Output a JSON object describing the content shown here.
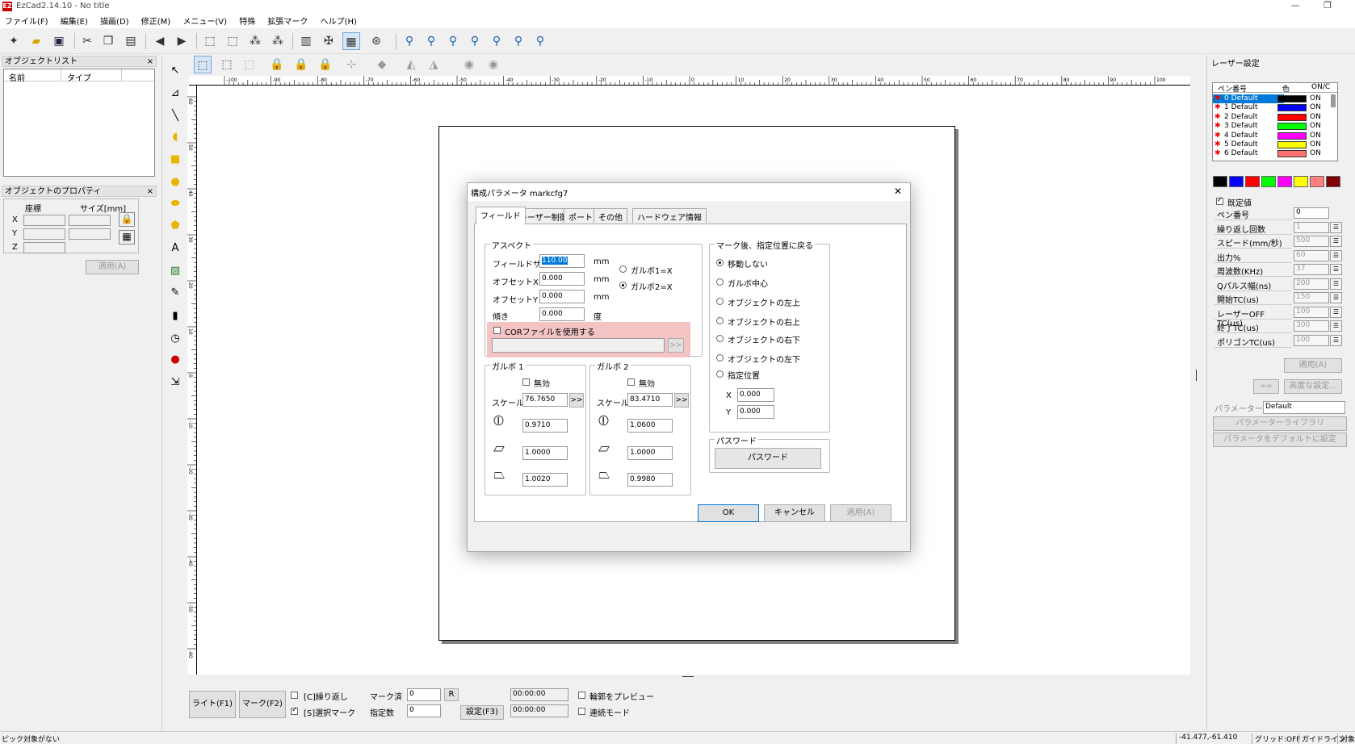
{
  "window": {
    "title": "EzCad2.14.10 - No title",
    "min": "—",
    "max": "❐"
  },
  "menu": [
    "ファイル(F)",
    "編集(E)",
    "描画(D)",
    "修正(M)",
    "メニュー(V)",
    "特殊",
    "拡張マーク",
    "ヘルプ(H)"
  ],
  "object_list": {
    "title": "オブジェクトリスト",
    "close": "×",
    "col_name": "名前",
    "col_type": "タイプ"
  },
  "object_props": {
    "title": "オブジェクトのプロパティ",
    "close": "×",
    "coord_label": "座標",
    "size_label": "サイズ[mm]",
    "x": "X",
    "y": "Y",
    "z": "Z",
    "apply": "適用(A)"
  },
  "ruler": {
    "h": [
      "-100",
      "-90",
      "-80",
      "-70",
      "-60",
      "-50",
      "-40",
      "-30",
      "-20",
      "-10",
      "0",
      "10",
      "20",
      "30",
      "40",
      "50",
      "60",
      "70",
      "80",
      "90",
      "100"
    ],
    "v": [
      "60",
      "50",
      "40",
      "30",
      "20",
      "10",
      "0",
      "-10",
      "-20",
      "-30",
      "-40",
      "-50",
      "-60"
    ]
  },
  "dialog": {
    "title": "構成パラメータ markcfg7",
    "close": "✕",
    "tabs": [
      "フィールド",
      "レーザー制御",
      "ポート",
      "その他",
      "ハードウェア情報"
    ],
    "aspect": {
      "legend": "アスペクト",
      "field_size_label": "フィールドサ",
      "field_size": "110.00",
      "offset_x_label": "オフセットX",
      "offset_x": "0.000",
      "offset_y_label": "オフセットY",
      "offset_y": "0.000",
      "tilt_label": "傾き",
      "tilt": "0.000",
      "unit_mm": "mm",
      "unit_deg": "度",
      "galvo1x": "ガルボ1=X",
      "galvo2x": "ガルボ2=X",
      "cor_label": "CORファイルを使用する",
      "browse": ">>"
    },
    "galvo1": {
      "legend": "ガルボ 1",
      "disable": "無効",
      "scale_label": "スケール",
      "scale": "76.7650",
      "more": ">>",
      "v1": "0.9710",
      "v2": "1.0000",
      "v3": "1.0020"
    },
    "galvo2": {
      "legend": "ガルボ 2",
      "disable": "無効",
      "scale_label": "スケール",
      "scale": "83.4710",
      "more": ">>",
      "v1": "1.0600",
      "v2": "1.0000",
      "v3": "0.9980"
    },
    "after_mark": {
      "legend": "マーク後、指定位置に戻る",
      "options": [
        "移動しない",
        "ガルボ中心",
        "オブジェクトの左上",
        "オブジェクトの右上",
        "オブジェクトの右下",
        "オブジェクトの左下",
        "指定位置"
      ],
      "x_label": "X",
      "x": "0.000",
      "y_label": "Y",
      "y": "0.000"
    },
    "password": {
      "legend": "パスワード",
      "button": "パスワード"
    },
    "ok": "OK",
    "cancel": "キャンセル",
    "apply": "適用(A)"
  },
  "bottom": {
    "light": "ライト(F1)",
    "mark": "マーク(F2)",
    "repeat": "[C]繰り返し",
    "select_mark": "[S]選択マーク",
    "marked_label": "マーク済",
    "marked": "0",
    "r": "R",
    "spec_label": "指定数",
    "spec": "0",
    "settings": "設定(F3)",
    "time1": "00:00:00",
    "time2": "00:00:00",
    "preview": "輪郭をプレビュー",
    "continuous": "連続モード"
  },
  "laser": {
    "title": "レーザー設定",
    "cols": [
      "ペン番号",
      "色",
      "ON/C"
    ],
    "pens": [
      {
        "name": "0 Default",
        "color": "#000000",
        "on": "ON"
      },
      {
        "name": "1 Default",
        "color": "#0000ff",
        "on": "ON"
      },
      {
        "name": "2 Default",
        "color": "#ff0000",
        "on": "ON"
      },
      {
        "name": "3 Default",
        "color": "#00ff00",
        "on": "ON"
      },
      {
        "name": "4 Default",
        "color": "#ff00ff",
        "on": "ON"
      },
      {
        "name": "5 Default",
        "color": "#ffff00",
        "on": "ON"
      },
      {
        "name": "6 Default",
        "color": "#ff7070",
        "on": "ON"
      }
    ],
    "palette": [
      "#000000",
      "#0000ff",
      "#ff0000",
      "#00ff00",
      "#ff00ff",
      "#ffff00",
      "#ff8080",
      "#800000"
    ],
    "default_label": "既定値",
    "params": [
      {
        "label": "ペン番号",
        "value": "0"
      },
      {
        "label": "繰り返し回数",
        "value": "1"
      },
      {
        "label": "スピード(mm/秒)",
        "value": "500"
      },
      {
        "label": "出力%",
        "value": "60"
      },
      {
        "label": "周波数(KHz)",
        "value": "37"
      },
      {
        "label": "Qパルス幅(ns)",
        "value": "200"
      },
      {
        "label": "開始TC(us)",
        "value": "150"
      },
      {
        "label": "レーザーOFF TC(us)",
        "value": "100"
      },
      {
        "label": "終了TC(us)",
        "value": "300"
      },
      {
        "label": "ポリゴンTC(us)",
        "value": "100"
      }
    ],
    "apply": "適用(A)",
    "advanced": "高度な設定...",
    "adv_icon": "∞∞",
    "param_name_label": "パラメーター名",
    "param_name": "Default",
    "library": "パラメーターライブラリ",
    "set_default": "パラメータをデフォルトに設定"
  },
  "status": {
    "left": "ピック対象がない",
    "coords": "-41.477,-61.410",
    "grid": "グリッド:OFF",
    "guide": "ガイドライン",
    "obj": "対象"
  }
}
